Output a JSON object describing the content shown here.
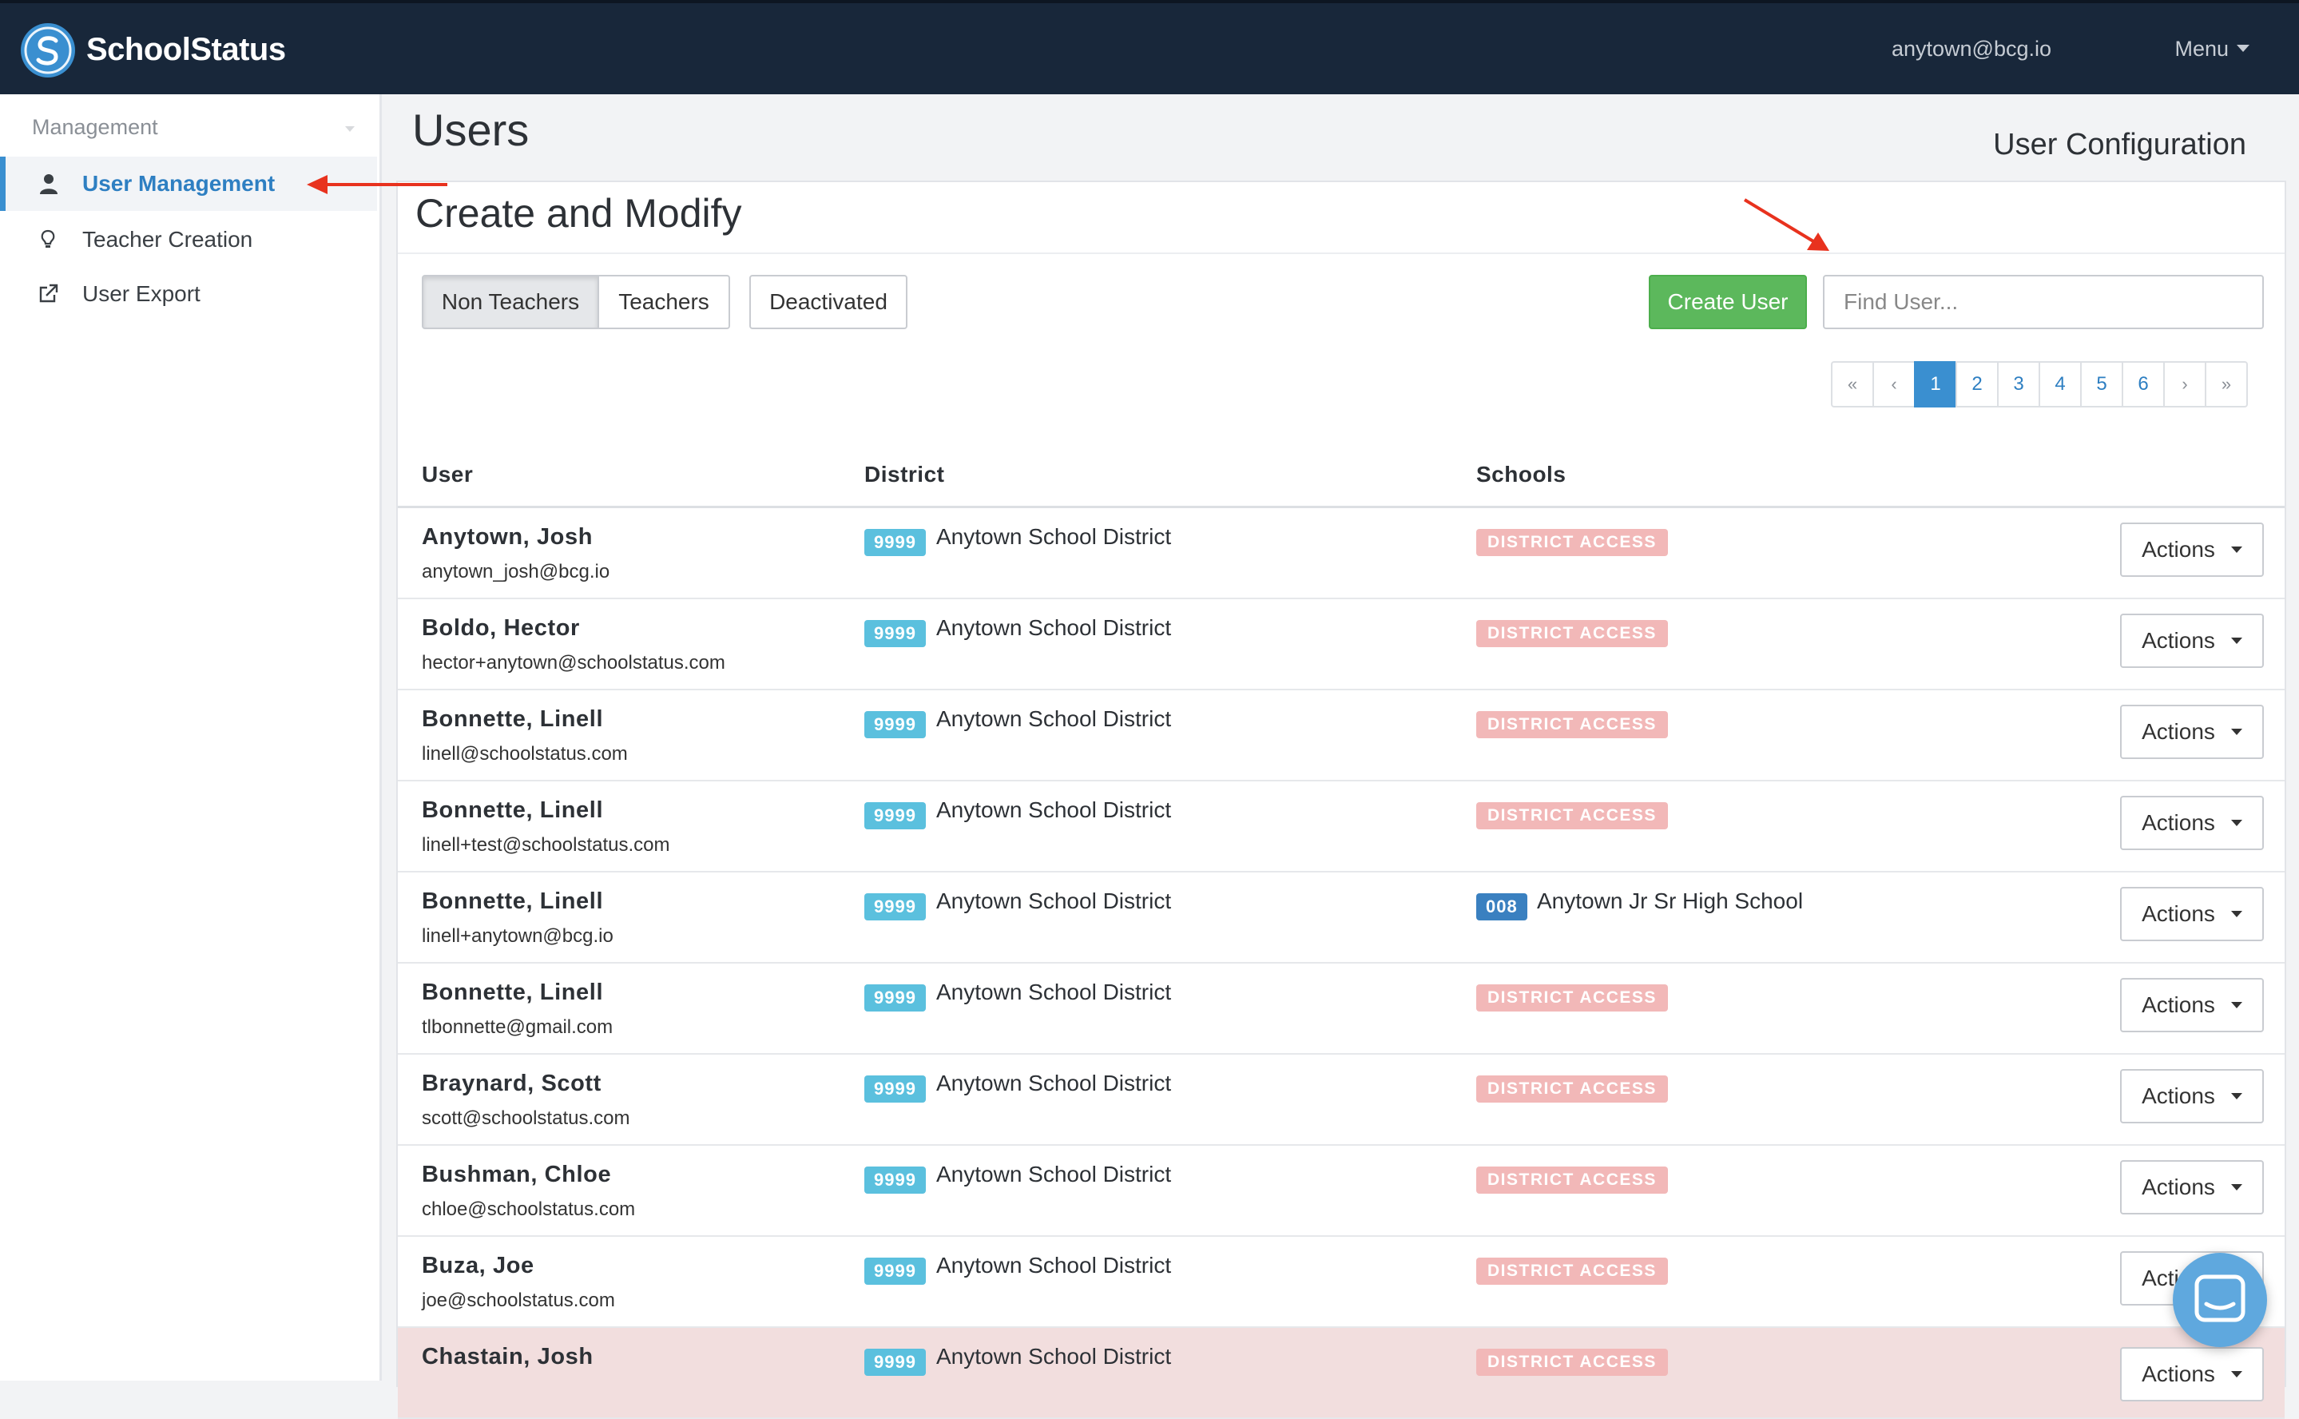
{
  "nav": {
    "brand": "SchoolStatus",
    "email": "anytown@bcg.io",
    "menu_label": "Menu"
  },
  "sidebar": {
    "heading": "Management",
    "items": [
      {
        "label": "User Management",
        "icon": "user-icon",
        "active": true
      },
      {
        "label": "Teacher Creation",
        "icon": "lightbulb-icon",
        "active": false
      },
      {
        "label": "User Export",
        "icon": "external-link-icon",
        "active": false
      }
    ]
  },
  "page": {
    "title": "Users",
    "subtitle": "User Configuration"
  },
  "panel": {
    "title": "Create and Modify",
    "filters": [
      "Non Teachers",
      "Teachers",
      "Deactivated"
    ],
    "active_filter": "Non Teachers",
    "create_label": "Create User",
    "search_placeholder": "Find User...",
    "pagination": {
      "first": "«",
      "prev": "‹",
      "pages": [
        "1",
        "2",
        "3",
        "4",
        "5",
        "6"
      ],
      "current": "1",
      "next": "›",
      "last": "»"
    }
  },
  "table": {
    "columns": [
      "User",
      "District",
      "Schools"
    ],
    "action_label": "Actions",
    "rows": [
      {
        "name": "Anytown, Josh",
        "email": "anytown_josh@bcg.io",
        "district_code": "9999",
        "district": "Anytown School District",
        "access": "DISTRICT ACCESS"
      },
      {
        "name": "Boldo, Hector",
        "email": "hector+anytown@schoolstatus.com",
        "district_code": "9999",
        "district": "Anytown School District",
        "access": "DISTRICT ACCESS"
      },
      {
        "name": "Bonnette, Linell",
        "email": "linell@schoolstatus.com",
        "district_code": "9999",
        "district": "Anytown School District",
        "access": "DISTRICT ACCESS"
      },
      {
        "name": "Bonnette, Linell",
        "email": "linell+test@schoolstatus.com",
        "district_code": "9999",
        "district": "Anytown School District",
        "access": "DISTRICT ACCESS"
      },
      {
        "name": "Bonnette, Linell",
        "email": "linell+anytown@bcg.io",
        "district_code": "9999",
        "district": "Anytown School District",
        "school_code": "008",
        "school": "Anytown Jr Sr High School"
      },
      {
        "name": "Bonnette, Linell",
        "email": "tlbonnette@gmail.com",
        "district_code": "9999",
        "district": "Anytown School District",
        "access": "DISTRICT ACCESS"
      },
      {
        "name": "Braynard, Scott",
        "email": "scott@schoolstatus.com",
        "district_code": "9999",
        "district": "Anytown School District",
        "access": "DISTRICT ACCESS"
      },
      {
        "name": "Bushman, Chloe",
        "email": "chloe@schoolstatus.com",
        "district_code": "9999",
        "district": "Anytown School District",
        "access": "DISTRICT ACCESS"
      },
      {
        "name": "Buza, Joe",
        "email": "joe@schoolstatus.com",
        "district_code": "9999",
        "district": "Anytown School District",
        "access": "DISTRICT ACCESS"
      },
      {
        "name": "Chastain, Josh",
        "email": "",
        "district_code": "9999",
        "district": "Anytown School District",
        "access": "DISTRICT ACCESS",
        "highlighted": true
      }
    ]
  },
  "colors": {
    "nav_bg": "#18273a",
    "accent": "#3a8fd0",
    "success": "#5cb85c",
    "info_badge": "#5bc0de",
    "access_badge": "#f2b8b8",
    "highlight_row": "#f2dede",
    "annotation_arrow": "#e8321e"
  }
}
